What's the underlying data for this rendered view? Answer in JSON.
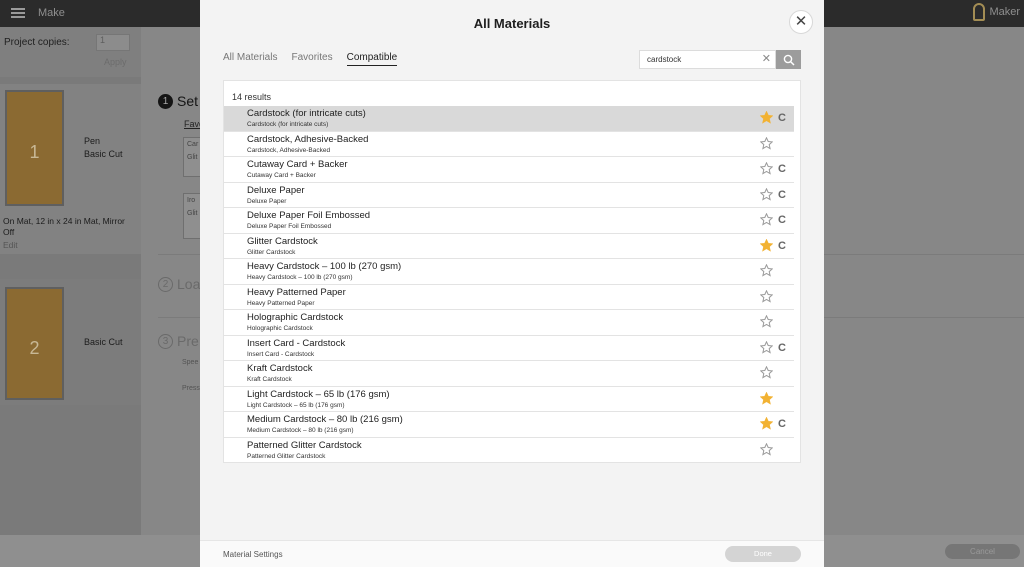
{
  "app": {
    "title": "Make",
    "machine_label": "Maker"
  },
  "left_panel": {
    "copies_label": "Project copies:",
    "copies_value": "1",
    "apply_label": "Apply",
    "mats": [
      {
        "number": "1",
        "tool_line1": "Pen",
        "tool_line2": "Basic Cut",
        "info": "On Mat, 12 in x 24 in Mat, Mirror Off",
        "edit": "Edit"
      },
      {
        "number": "2",
        "tool_line1": "Basic Cut"
      }
    ]
  },
  "steps": [
    {
      "number": "1",
      "label": "Set",
      "sub": "Favo"
    },
    {
      "number": "2",
      "label": "Loa"
    },
    {
      "number": "3",
      "label": "Pre",
      "sub1": "Spee",
      "sub2": "Press"
    }
  ],
  "background_ghosts": {
    "box1_line1": "Car",
    "box1_line2": "Glit",
    "box2_line1": "Iro",
    "box2_line2": "Glit"
  },
  "bottom": {
    "cancel_label": "Cancel"
  },
  "modal": {
    "title": "All Materials",
    "close_symbol": "✕",
    "tabs": [
      {
        "label": "All Materials",
        "active": false
      },
      {
        "label": "Favorites",
        "active": false
      },
      {
        "label": "Compatible",
        "active": true
      }
    ],
    "search": {
      "value": "cardstock",
      "clear_symbol": "✕"
    },
    "results_count": "14 results",
    "items": [
      {
        "name": "Cardstock (for intricate cuts)",
        "sub": "Cardstock (for intricate cuts)",
        "favorite": true,
        "cut_icon": true,
        "selected": true
      },
      {
        "name": "Cardstock, Adhesive-Backed",
        "sub": "Cardstock, Adhesive-Backed",
        "favorite": false,
        "cut_icon": false,
        "selected": false
      },
      {
        "name": "Cutaway Card + Backer",
        "sub": "Cutaway Card + Backer",
        "favorite": false,
        "cut_icon": true,
        "selected": false
      },
      {
        "name": "Deluxe Paper",
        "sub": "Deluxe Paper",
        "favorite": false,
        "cut_icon": true,
        "selected": false
      },
      {
        "name": "Deluxe Paper Foil Embossed",
        "sub": "Deluxe Paper Foil Embossed",
        "favorite": false,
        "cut_icon": true,
        "selected": false
      },
      {
        "name": "Glitter Cardstock",
        "sub": "Glitter Cardstock",
        "favorite": true,
        "cut_icon": true,
        "selected": false
      },
      {
        "name": "Heavy Cardstock – 100 lb (270 gsm)",
        "sub": "Heavy Cardstock – 100 lb (270 gsm)",
        "favorite": false,
        "cut_icon": false,
        "selected": false
      },
      {
        "name": "Heavy Patterned Paper",
        "sub": "Heavy Patterned Paper",
        "favorite": false,
        "cut_icon": false,
        "selected": false
      },
      {
        "name": "Holographic Cardstock",
        "sub": "Holographic Cardstock",
        "favorite": false,
        "cut_icon": false,
        "selected": false
      },
      {
        "name": "Insert Card - Cardstock",
        "sub": "Insert Card - Cardstock",
        "favorite": false,
        "cut_icon": true,
        "selected": false
      },
      {
        "name": "Kraft Cardstock",
        "sub": "Kraft Cardstock",
        "favorite": false,
        "cut_icon": false,
        "selected": false
      },
      {
        "name": "Light Cardstock – 65 lb (176 gsm)",
        "sub": "Light Cardstock – 65 lb (176 gsm)",
        "favorite": true,
        "cut_icon": false,
        "selected": false
      },
      {
        "name": "Medium Cardstock – 80 lb (216 gsm)",
        "sub": "Medium Cardstock – 80 lb (216 gsm)",
        "favorite": true,
        "cut_icon": true,
        "selected": false
      },
      {
        "name": "Patterned Glitter Cardstock",
        "sub": "Patterned Glitter Cardstock",
        "favorite": false,
        "cut_icon": false,
        "selected": false
      }
    ],
    "cut_icon_glyph": "C",
    "footer": {
      "material_settings_label": "Material Settings",
      "done_label": "Done"
    }
  },
  "colors": {
    "star_filled": "#f2b233",
    "star_empty": "#9a9a9a",
    "mat_brown": "#8b6a32"
  }
}
